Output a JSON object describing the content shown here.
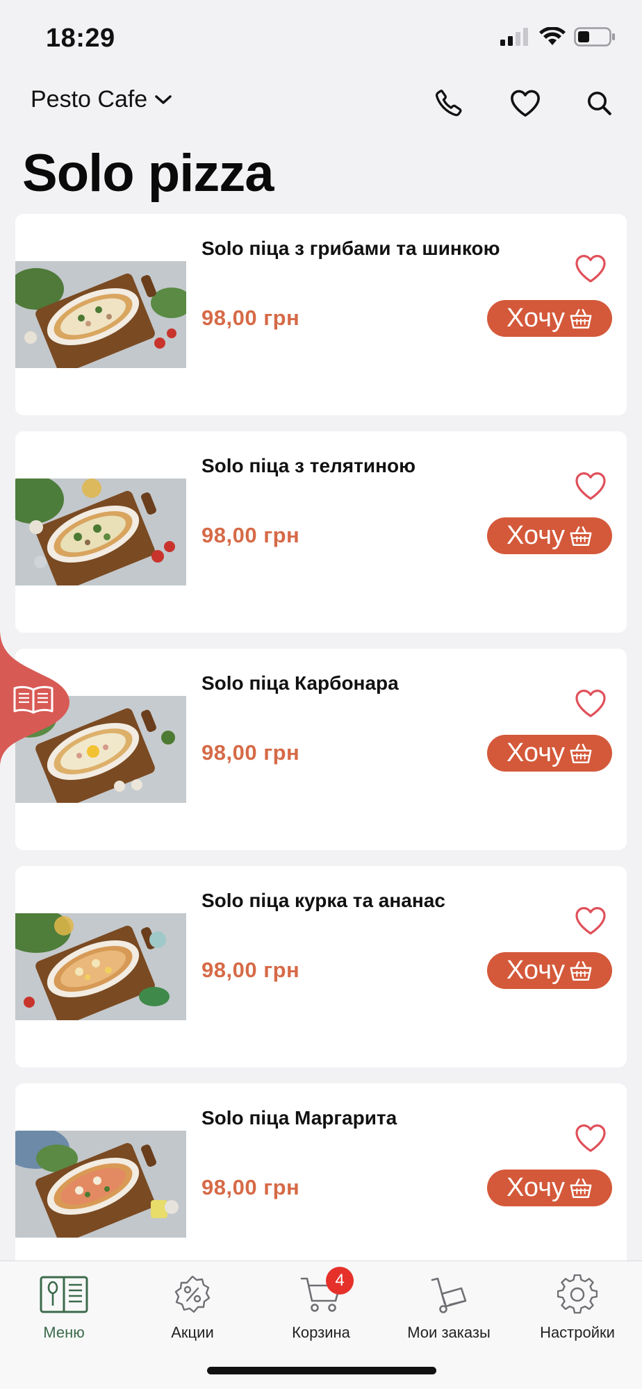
{
  "status_bar": {
    "time": "18:29",
    "icons": [
      "cellular-signal-icon",
      "wifi-icon",
      "battery-icon"
    ]
  },
  "header": {
    "venue_name": "Pesto Cafe",
    "icons": [
      "chevron-down-icon",
      "phone-icon",
      "heart-icon",
      "search-icon"
    ]
  },
  "page": {
    "title": "Solo pizza"
  },
  "products": [
    {
      "name": "Solo піца з грибами та шинкою",
      "price": "98,00 грн",
      "button_label": "Хочу"
    },
    {
      "name": "Solo піца з телятиною",
      "price": "98,00 грн",
      "button_label": "Хочу"
    },
    {
      "name": "Solo піца Карбонара",
      "price": "98,00 грн",
      "button_label": "Хочу"
    },
    {
      "name": "Solo піца курка та ананас",
      "price": "98,00 грн",
      "button_label": "Хочу"
    },
    {
      "name": "Solo піца Маргарита",
      "price": "98,00 грн",
      "button_label": "Хочу"
    }
  ],
  "tab_bar": {
    "items": [
      {
        "label": "Меню",
        "icon": "menu-book-icon",
        "active": true
      },
      {
        "label": "Акции",
        "icon": "discount-icon",
        "active": false
      },
      {
        "label": "Корзина",
        "icon": "cart-icon",
        "badge": "4",
        "active": false
      },
      {
        "label": "Мои заказы",
        "icon": "orders-cart-icon",
        "active": false
      },
      {
        "label": "Настройки",
        "icon": "gear-icon",
        "active": false
      }
    ]
  },
  "colors": {
    "accent": "#d4593a",
    "price": "#d66a47",
    "favorite": "#e0505a",
    "active_tab": "#3b6a4a",
    "badge": "#e5312a",
    "float_tab": "#d85a55"
  }
}
